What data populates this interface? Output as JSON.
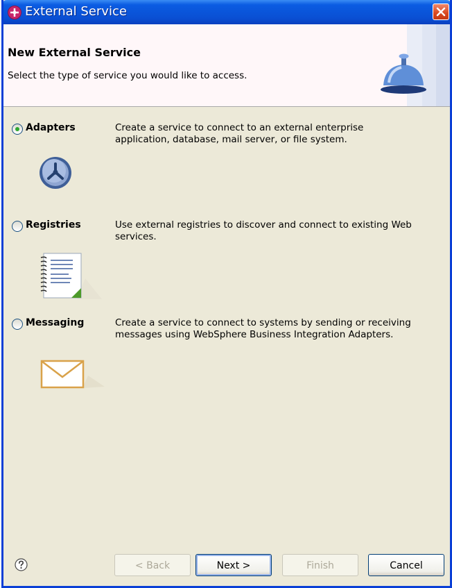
{
  "window": {
    "title": "External Service"
  },
  "banner": {
    "title": "New External Service",
    "subtitle": "Select the type of service you would like to access."
  },
  "options": [
    {
      "label": "Adapters",
      "description_line1": "Create a service to connect to an external enterprise",
      "description_line2": "application, database, mail server, or file system.",
      "selected": true,
      "icon": "adapter-icon"
    },
    {
      "label": "Registries",
      "description_line1": "Use external registries to discover and connect to existing Web",
      "description_line2": "services.",
      "selected": false,
      "icon": "registry-notebook-icon"
    },
    {
      "label": "Messaging",
      "description_line1": "Create a service to connect to systems by sending or receiving",
      "description_line2": "messages using WebSphere Business Integration Adapters.",
      "selected": false,
      "icon": "envelope-icon"
    }
  ],
  "buttons": {
    "back": "< Back",
    "next": "Next >",
    "finish": "Finish",
    "cancel": "Cancel"
  },
  "colors": {
    "titlebar": "#0a4fd3",
    "dialog_bg": "#ece9d8",
    "banner_bg": "#fff7f9",
    "radio_selected": "#2fa82f"
  }
}
